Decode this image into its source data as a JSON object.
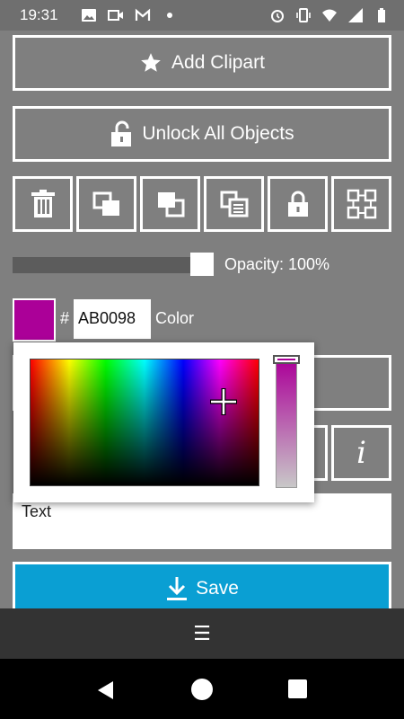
{
  "status_bar": {
    "time": "19:31",
    "left_icons": [
      "photo-icon",
      "video-icon",
      "gmail-icon",
      "dot-icon"
    ],
    "right_icons": [
      "alarm-icon",
      "vibrate-icon",
      "wifi-icon",
      "signal-icon",
      "battery-icon"
    ]
  },
  "toolbar": {
    "add_clipart_label": "Add Clipart",
    "unlock_all_label": "Unlock All Objects",
    "icon_buttons": [
      "delete-icon",
      "bring-to-front-icon",
      "send-to-back-icon",
      "duplicate-icon",
      "lock-icon",
      "group-icon"
    ]
  },
  "opacity": {
    "label": "Opacity: 100%",
    "value_percent": 100
  },
  "color": {
    "hash": "#",
    "hex_value": "AB0098",
    "label": "Color",
    "swatch_hex": "#AB0098"
  },
  "info_button_label": "i",
  "text_input": {
    "value": "Text"
  },
  "save_label": "Save",
  "bottom_menu_glyph": "☰",
  "colors": {
    "background": "#7f7f7f",
    "accent_save": "#0a9fd3",
    "selected_color": "#AB0098"
  }
}
